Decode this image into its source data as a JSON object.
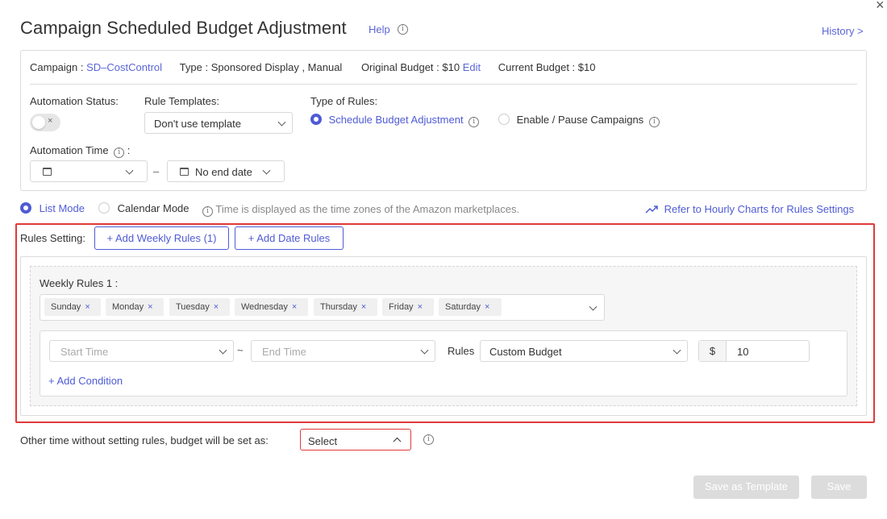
{
  "header": {
    "title": "Campaign Scheduled Budget Adjustment",
    "help": "Help",
    "history": "History",
    "history_chevron": ">",
    "close": "×"
  },
  "campaign_info": {
    "campaign_label": "Campaign :",
    "campaign_value": "SD–CostControl",
    "type_label": "Type :",
    "type_value": "Sponsored Display , Manual",
    "original_budget_label": "Original Budget :",
    "original_budget_value": "$10",
    "edit": "Edit",
    "current_budget_label": "Current Budget :",
    "current_budget_value": "$10"
  },
  "automation": {
    "status_label": "Automation Status:",
    "toggle_x": "×",
    "rule_templates_label": "Rule Templates:",
    "rule_template_value": "Don't use template",
    "type_of_rules_label": "Type of Rules:",
    "rule_type_options": [
      "Schedule Budget Adjustment",
      "Enable / Pause Campaigns"
    ],
    "time_label": "Automation Time",
    "time_colon": ":",
    "end_date_value": "No end date",
    "dash": "–"
  },
  "mode": {
    "list_mode": "List Mode",
    "calendar_mode": "Calendar Mode",
    "timezone_note": "Time is displayed as the time zones of the Amazon marketplaces.",
    "hourly_charts_link": "Refer to Hourly Charts for Rules Settings"
  },
  "rules": {
    "setting_label": "Rules Setting:",
    "add_weekly": "+ Add Weekly Rules (1)",
    "add_date": "+ Add Date Rules",
    "weekly_rules_label": "Weekly Rules 1 :",
    "days": [
      "Sunday",
      "Monday",
      "Tuesday",
      "Wednesday",
      "Thursday",
      "Friday",
      "Saturday"
    ],
    "tag_remove": "×",
    "start_time_placeholder": "Start Time",
    "tilde": "~",
    "end_time_placeholder": "End Time",
    "rules_label": "Rules",
    "rule_value": "Custom Budget",
    "currency": "$",
    "amount": "10",
    "add_condition": "+ Add Condition"
  },
  "other": {
    "label": "Other time without setting rules, budget will be set as:",
    "select_value": "Select"
  },
  "footer": {
    "save_as_template": "Save as Template",
    "save": "Save"
  },
  "colors": {
    "accent": "#4f5bd5",
    "error_border": "#e03a3a",
    "disabled_button": "#dcdcdc"
  }
}
